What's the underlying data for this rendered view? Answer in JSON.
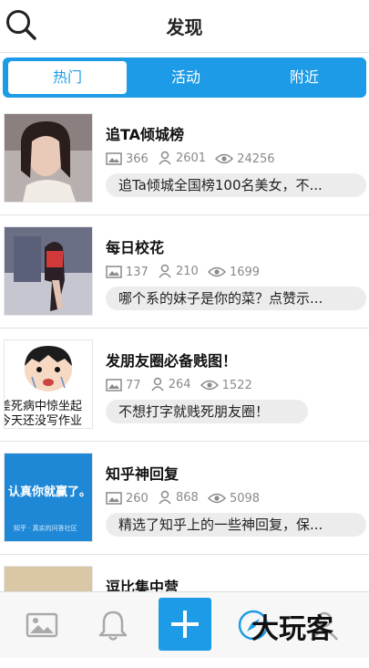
{
  "header": {
    "title": "发现"
  },
  "tabs": [
    {
      "label": "热门"
    },
    {
      "label": "活动"
    },
    {
      "label": "附近"
    }
  ],
  "items": [
    {
      "title": "追TA倾城榜",
      "images": "366",
      "users": "2601",
      "views": "24256",
      "desc": "追Ta倾城全国榜100名美女，不..."
    },
    {
      "title": "每日校花",
      "images": "137",
      "users": "210",
      "views": "1699",
      "desc": "哪个系的妹子是你的菜？点赞示..."
    },
    {
      "title": "发朋友圈必备贱图！",
      "images": "77",
      "users": "264",
      "views": "1522",
      "desc": "不想打字就贱死朋友圈！"
    },
    {
      "title": "知乎神回复",
      "images": "260",
      "users": "868",
      "views": "5098",
      "desc": "精选了知乎上的一些神回复，保..."
    },
    {
      "title": "逗比集中营"
    }
  ],
  "thumb_text": {
    "item3_line1": "差死病中惊坐起",
    "item3_line2": "今天还没写作业",
    "item4_main": "认真你就赢了。",
    "item4_sub": "知乎 · 真实的问答社区"
  },
  "watermark": "大玩客",
  "colors": {
    "accent": "#1d9be6",
    "pill": "#ececec",
    "muted": "#8a8a8a"
  }
}
